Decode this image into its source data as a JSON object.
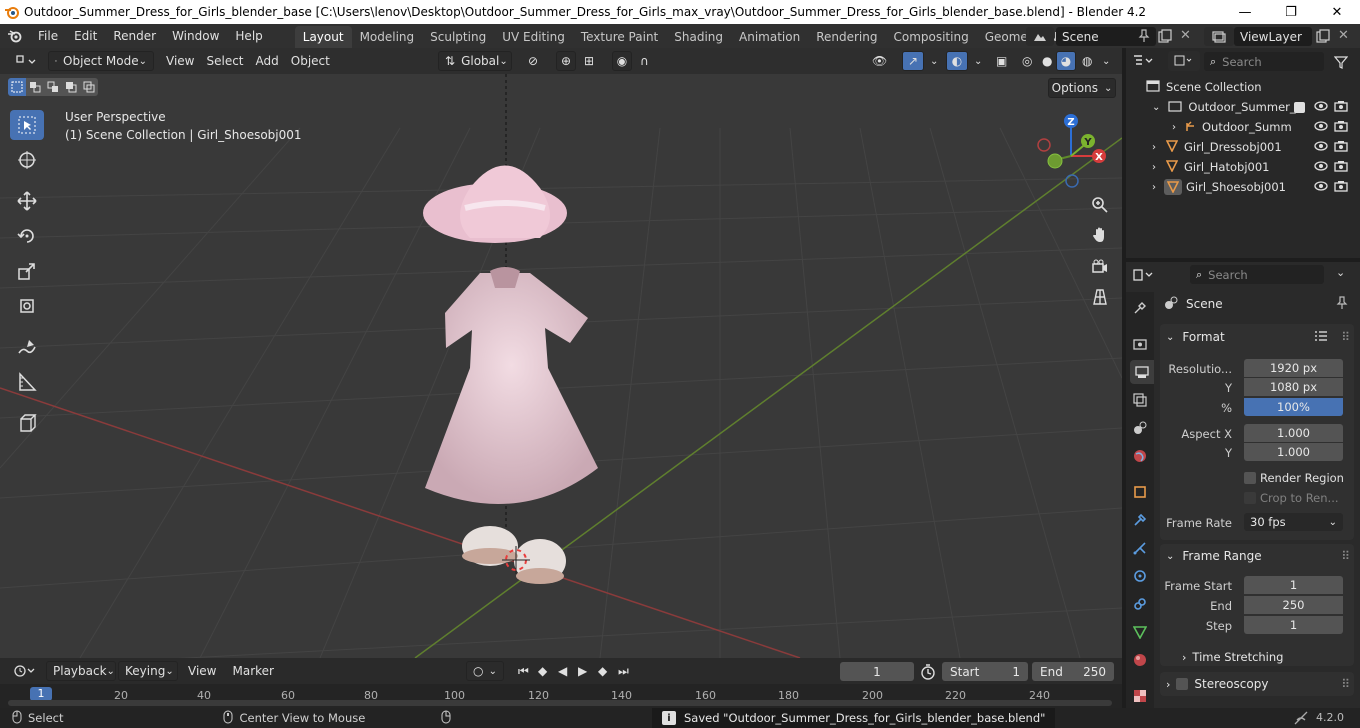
{
  "titlebar": {
    "title": "Outdoor_Summer_Dress_for_Girls_blender_base [C:\\Users\\lenov\\Desktop\\Outdoor_Summer_Dress_for_Girls_max_vray\\Outdoor_Summer_Dress_for_Girls_blender_base.blend] - Blender 4.2",
    "minimize": "—",
    "maximize": "❐",
    "close": "✕"
  },
  "menu": [
    "File",
    "Edit",
    "Render",
    "Window",
    "Help"
  ],
  "workspaces": [
    "Layout",
    "Modeling",
    "Sculpting",
    "UV Editing",
    "Texture Paint",
    "Shading",
    "Animation",
    "Rendering",
    "Compositing",
    "Geometry Nod"
  ],
  "active_workspace": "Layout",
  "scene_name": "Scene",
  "view_layer": "ViewLayer",
  "viewport": {
    "mode": "Object Mode",
    "menus": [
      "View",
      "Select",
      "Add",
      "Object"
    ],
    "transform_orientation": "Global",
    "options_label": "Options",
    "perspective_label": "User Perspective",
    "collection_label": "(1) Scene Collection | Girl_Shoesobj001",
    "gizmo_axes": {
      "x": "X",
      "y": "Y",
      "z": "Z"
    }
  },
  "outliner": {
    "search_placeholder": "Search",
    "root": "Scene Collection",
    "items": [
      {
        "label": "Outdoor_Summer_D"
      },
      {
        "label": "Outdoor_Summ"
      },
      {
        "label": "Girl_Dressobj001"
      },
      {
        "label": "Girl_Hatobj001"
      },
      {
        "label": "Girl_Shoesobj001"
      }
    ]
  },
  "properties": {
    "search_placeholder": "Search",
    "context": "Scene",
    "format_panel": "Format",
    "resolution_label": "Resolutio...",
    "resolution_x": "1920 px",
    "y_label": "Y",
    "resolution_y": "1080 px",
    "percent_label": "%",
    "resolution_percent": "100%",
    "aspect_x_label": "Aspect X",
    "aspect_x": "1.000",
    "aspect_y": "1.000",
    "render_region": "Render Region",
    "crop_to_render": "Crop to Ren...",
    "frame_rate_label": "Frame Rate",
    "frame_rate": "30 fps",
    "frame_range_panel": "Frame Range",
    "frame_start_label": "Frame Start",
    "frame_start": "1",
    "end_label": "End",
    "frame_end": "250",
    "step_label": "Step",
    "frame_step": "1",
    "time_stretching": "Time Stretching",
    "stereoscopy": "Stereoscopy"
  },
  "timeline": {
    "menus": [
      "Playback",
      "Keying",
      "View",
      "Marker"
    ],
    "current_frame": "1",
    "start_label": "Start",
    "start": "1",
    "end_label": "End",
    "end": "250",
    "ruler": [
      "1",
      "20",
      "40",
      "60",
      "80",
      "100",
      "120",
      "140",
      "160",
      "180",
      "200",
      "220",
      "240"
    ]
  },
  "statusbar": {
    "select": "Select",
    "center_view": "Center View to Mouse",
    "message": "Saved \"Outdoor_Summer_Dress_for_Girls_blender_base.blend\"",
    "version": "4.2.0"
  }
}
